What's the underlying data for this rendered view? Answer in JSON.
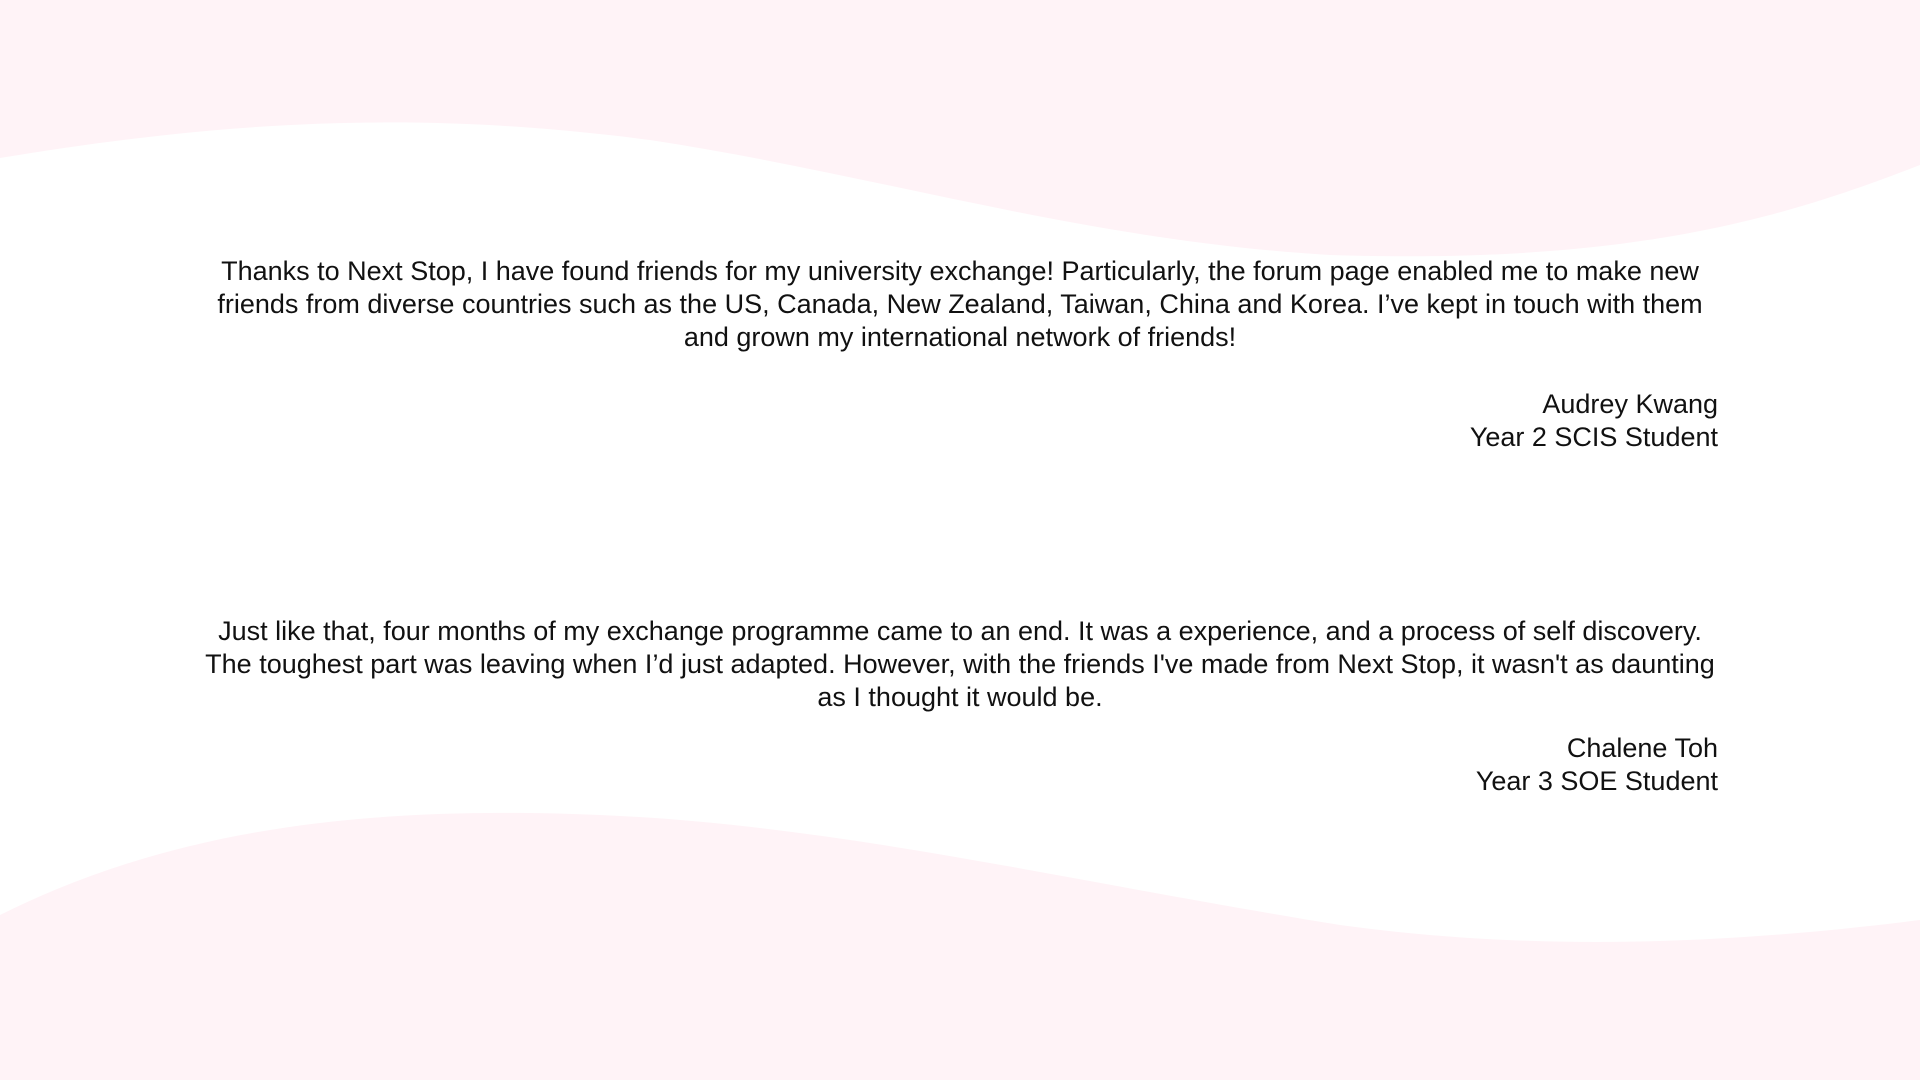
{
  "colors": {
    "background": "#ffffff",
    "wave": "#fff3f7",
    "text": "#111111"
  },
  "testimonials": [
    {
      "quote": "Thanks to Next Stop, I have found friends for my university exchange! Particularly, the forum page enabled me to make new friends from diverse countries such as the US, Canada, New Zealand, Taiwan, China and Korea. I’ve kept in touch with them and grown my international network of friends!",
      "name": "Audrey Kwang",
      "role": "Year 2 SCIS Student"
    },
    {
      "quote": "Just like that, four months of my exchange programme came to an end.  It was a experience, and a process of self discovery. The toughest part was leaving when I’d just adapted. However, with the friends I've made from Next Stop, it wasn't as daunting as I thought it would be.",
      "name": "Chalene Toh",
      "role": "Year 3 SOE Student"
    }
  ]
}
